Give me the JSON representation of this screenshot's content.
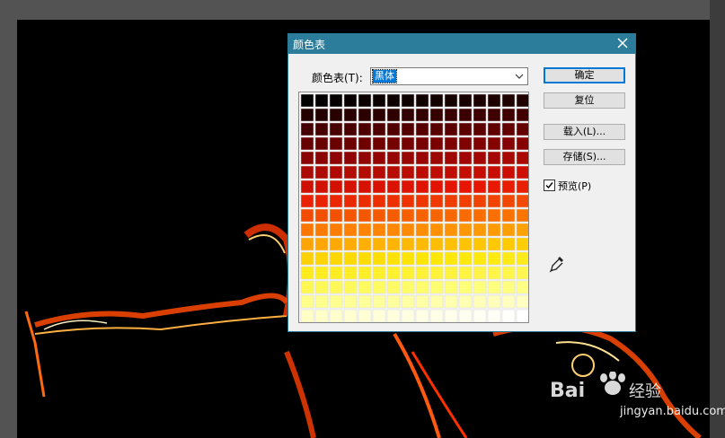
{
  "dialog": {
    "title": "颜色表",
    "table_label": "颜色表(T):",
    "table_value": "黑体",
    "buttons": {
      "ok": "确定",
      "reset": "复位",
      "load": "载入(L)...",
      "save": "存储(S)..."
    },
    "preview": {
      "label": "预览(P)",
      "checked": true
    }
  },
  "watermark": {
    "site": "jingyan.baidu.com"
  },
  "colors": {
    "titlebar": "#2b7d9b",
    "canvas_bg": "#000000",
    "dialog_bg": "#f0f0f0",
    "selection": "#0078d7"
  },
  "icons": [
    "close-icon",
    "chevron-down-icon",
    "check-icon",
    "eyedropper-icon",
    "baidu-paw-icon"
  ]
}
